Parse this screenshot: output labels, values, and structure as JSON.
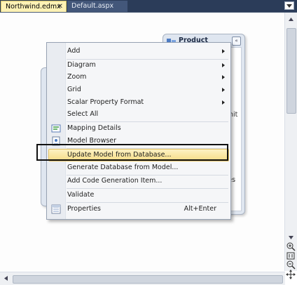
{
  "tabs": [
    {
      "label": "Northwind.edmx",
      "close": "✕",
      "active": true
    },
    {
      "label": "Default.aspx",
      "active": false
    }
  ],
  "entities": {
    "product": {
      "title": "Product",
      "collapse_glyph": "«"
    },
    "left_entity": {},
    "fragments": {
      "nit": "nit",
      "rties": "rties"
    }
  },
  "context_menu": {
    "items": [
      {
        "label": "Add",
        "submenu": true
      },
      {
        "label": "Diagram",
        "submenu": true
      },
      {
        "label": "Zoom",
        "submenu": true
      },
      {
        "label": "Grid",
        "submenu": true
      },
      {
        "label": "Scalar Property Format",
        "submenu": true
      },
      {
        "label": "Select All"
      },
      {
        "label": "Mapping Details",
        "icon": "mapping-details-icon"
      },
      {
        "label": "Model Browser",
        "icon": "model-browser-icon"
      },
      {
        "label": "Update Model from Database...",
        "highlighted": true
      },
      {
        "label": "Generate Database from Model..."
      },
      {
        "label": "Add Code Generation Item..."
      },
      {
        "label": "Validate"
      },
      {
        "label": "Properties",
        "icon": "properties-icon",
        "shortcut": "Alt+Enter"
      }
    ]
  },
  "colors": {
    "tabbar": "#2b3c59",
    "active_tab": "#fdf2b5",
    "menu_highlight": "#f6dc86",
    "callout_border": "#111111"
  }
}
